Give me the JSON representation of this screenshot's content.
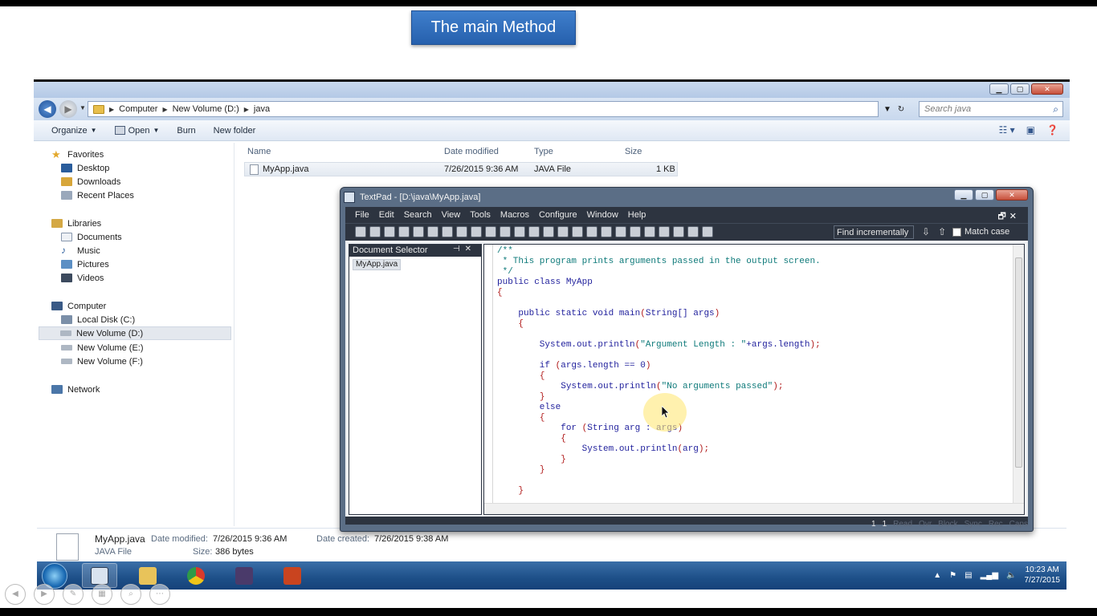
{
  "slide": {
    "title": "The main Method"
  },
  "explorer": {
    "breadcrumb": [
      "Computer",
      "New Volume (D:)",
      "java"
    ],
    "search_placeholder": "Search java",
    "toolbar": {
      "organize": "Organize",
      "open": "Open",
      "burn": "Burn",
      "new_folder": "New folder"
    },
    "nav": {
      "favorites": "Favorites",
      "favorites_items": [
        "Desktop",
        "Downloads",
        "Recent Places"
      ],
      "libraries": "Libraries",
      "libraries_items": [
        "Documents",
        "Music",
        "Pictures",
        "Videos"
      ],
      "computer": "Computer",
      "computer_items": [
        "Local Disk (C:)",
        "New Volume (D:)",
        "New Volume (E:)",
        "New Volume (F:)"
      ],
      "network": "Network"
    },
    "columns": {
      "name": "Name",
      "date": "Date modified",
      "type": "Type",
      "size": "Size"
    },
    "files": [
      {
        "name": "MyApp.java",
        "date": "7/26/2015 9:36 AM",
        "type": "JAVA File",
        "size": "1 KB"
      }
    ],
    "details": {
      "filename": "MyApp.java",
      "modified_label": "Date modified:",
      "modified_value": "7/26/2015 9:36 AM",
      "created_label": "Date created:",
      "created_value": "7/26/2015 9:38 AM",
      "type": "JAVA File",
      "size_label": "Size:",
      "size_value": "386 bytes"
    }
  },
  "textpad": {
    "title": "TextPad - [D:\\java\\MyApp.java]",
    "menus": [
      "File",
      "Edit",
      "Search",
      "View",
      "Tools",
      "Macros",
      "Configure",
      "Window",
      "Help"
    ],
    "find_incrementally": "Find incrementally",
    "match_case": "Match case",
    "doc_selector": {
      "title": "Document Selector",
      "files": [
        "MyApp.java"
      ]
    },
    "code": [
      "/**",
      " * This program prints arguments passed in the output screen.",
      " */",
      "public class MyApp",
      "{",
      "",
      "    public static void main(String[] args)",
      "    {",
      "",
      "        System.out.println(\"Argument Length : \"+args.length);",
      "",
      "        if (args.length == 0)",
      "        {",
      "            System.out.println(\"No arguments passed\");",
      "        }",
      "        else",
      "        {",
      "            for (String arg : args)",
      "            {",
      "                System.out.println(arg);",
      "            }",
      "        }",
      "",
      "    }"
    ],
    "status": {
      "line": "1",
      "col": "1",
      "read": "Read",
      "ovr": "Ovr",
      "block": "Block",
      "sync": "Sync",
      "rec": "Rec",
      "caps": "Caps"
    }
  },
  "taskbar": {
    "time": "10:23 AM",
    "date": "7/27/2015"
  }
}
